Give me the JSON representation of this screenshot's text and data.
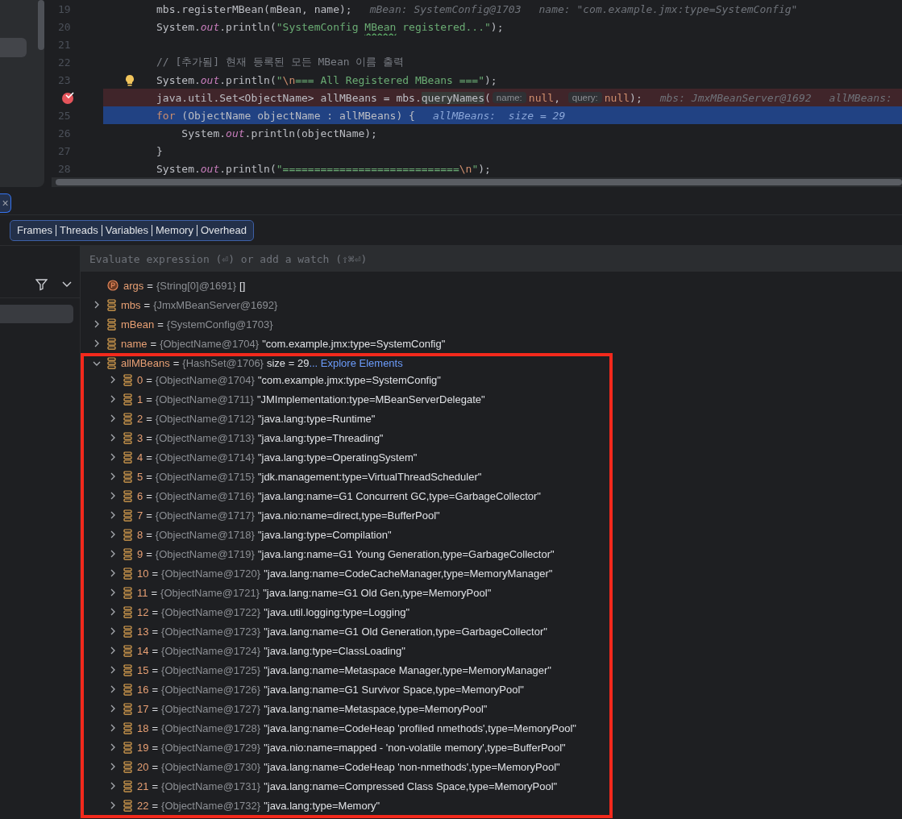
{
  "editor": {
    "lines": [
      {
        "number": "19",
        "breakpoint": false,
        "execution": false,
        "intention": false,
        "segments": [
          {
            "kind": "plain",
            "text": "mbs.registerMBean(mBean, name);"
          },
          {
            "kind": "hint",
            "text": "mBean: SystemConfig@1703"
          },
          {
            "kind": "hint",
            "text": "name: \"com.example.jmx:type=SystemConfig\""
          }
        ]
      },
      {
        "number": "20",
        "breakpoint": false,
        "execution": false,
        "intention": false,
        "segments": [
          {
            "kind": "plain",
            "text": "System."
          },
          {
            "kind": "field",
            "text": "out"
          },
          {
            "kind": "plain",
            "text": ".println("
          },
          {
            "kind": "string",
            "text": "\"SystemConfig "
          },
          {
            "kind": "typo",
            "text": "MBean"
          },
          {
            "kind": "string",
            "text": " registered...\""
          },
          {
            "kind": "plain",
            "text": ");"
          }
        ]
      },
      {
        "number": "21",
        "breakpoint": false,
        "execution": false,
        "intention": false
      },
      {
        "number": "22",
        "breakpoint": false,
        "execution": false,
        "intention": false,
        "segments": [
          {
            "kind": "comment",
            "text": "// [추가됨] 현재 등록된 모든 MBean 이름 출력"
          }
        ]
      },
      {
        "number": "23",
        "breakpoint": false,
        "execution": false,
        "intention": true,
        "segments": [
          {
            "kind": "plain",
            "text": "System."
          },
          {
            "kind": "field",
            "text": "out"
          },
          {
            "kind": "plain",
            "text": ".println("
          },
          {
            "kind": "string",
            "text": "\""
          },
          {
            "kind": "escape",
            "text": "\\n"
          },
          {
            "kind": "string",
            "text": "=== All Registered MBeans ===\""
          },
          {
            "kind": "plain",
            "text": ");"
          }
        ]
      },
      {
        "breakpoint": true,
        "execution": false,
        "intention": false,
        "segments": [
          {
            "kind": "plain",
            "text": "java.util.Set<ObjectName> allMBeans = mbs."
          },
          {
            "kind": "usage",
            "text": "queryNames"
          },
          {
            "kind": "plain",
            "text": "("
          },
          {
            "kind": "param",
            "text": "name:"
          },
          {
            "kind": "keyword",
            "text": "null"
          },
          {
            "kind": "plain",
            "text": ", "
          },
          {
            "kind": "param",
            "text": "query:"
          },
          {
            "kind": "keyword",
            "text": "null"
          },
          {
            "kind": "plain",
            "text": ");"
          },
          {
            "kind": "hint",
            "text": "mbs: JmxMBeanServer@1692"
          },
          {
            "kind": "hint",
            "text": "allMBeans:"
          }
        ]
      },
      {
        "number": "25",
        "breakpoint": false,
        "execution": true,
        "intention": false,
        "segments": [
          {
            "kind": "keyword",
            "text": "for"
          },
          {
            "kind": "plain",
            "text": " (ObjectName objectName : allMBeans) {"
          },
          {
            "kind": "hint",
            "text": "allMBeans:  size = 29"
          }
        ]
      },
      {
        "number": "26",
        "breakpoint": false,
        "execution": false,
        "intention": false,
        "segments": [
          {
            "kind": "plain",
            "text": "    System."
          },
          {
            "kind": "field",
            "text": "out"
          },
          {
            "kind": "plain",
            "text": ".println(objectName);"
          }
        ]
      },
      {
        "number": "27",
        "breakpoint": false,
        "execution": false,
        "intention": false,
        "segments": [
          {
            "kind": "plain",
            "text": "}"
          }
        ]
      },
      {
        "number": "28",
        "breakpoint": false,
        "execution": false,
        "intention": false,
        "segments": [
          {
            "kind": "plain",
            "text": "System."
          },
          {
            "kind": "field",
            "text": "out"
          },
          {
            "kind": "plain",
            "text": ".println("
          },
          {
            "kind": "string",
            "text": "\"============================"
          },
          {
            "kind": "escape",
            "text": "\\n"
          },
          {
            "kind": "string",
            "text": "\""
          },
          {
            "kind": "plain",
            "text": ");"
          }
        ]
      }
    ]
  },
  "session_tab": {
    "close": "×"
  },
  "view_tabs": [
    "Frames",
    "Threads",
    "Variables",
    "Memory",
    "Overhead"
  ],
  "evaluate": {
    "placeholder": "Evaluate expression (⏎) or add a watch (⇧⌘⏎)"
  },
  "variables": [
    {
      "kind": "param",
      "name": "args",
      "equals": "=",
      "type": "{String[0]@1691}",
      "value": "[]",
      "boxed": false
    },
    {
      "kind": "field",
      "name": "mbs",
      "equals": "=",
      "type": "{JmxMBeanServer@1692}",
      "expanded": false,
      "boxed": false
    },
    {
      "kind": "field",
      "name": "mBean",
      "equals": "=",
      "type": "{SystemConfig@1703}",
      "expanded": false,
      "boxed": false
    },
    {
      "kind": "field",
      "name": "name",
      "equals": "=",
      "type": "{ObjectName@1704}",
      "value": "\"com.example.jmx:type=SystemConfig\"",
      "expanded": false,
      "boxed": false
    },
    {
      "kind": "field",
      "name": "allMBeans",
      "equals": "=",
      "type": "{HashSet@1706}",
      "value": "size = 29",
      "link": "... Explore Elements",
      "expanded": true,
      "boxed": true,
      "children": [
        {
          "kind": "field",
          "name": "0",
          "equals": "=",
          "type": "{ObjectName@1704}",
          "value": "\"com.example.jmx:type=SystemConfig\"",
          "expanded": false
        },
        {
          "kind": "field",
          "name": "1",
          "equals": "=",
          "type": "{ObjectName@1711}",
          "value": "\"JMImplementation:type=MBeanServerDelegate\"",
          "expanded": false
        },
        {
          "kind": "field",
          "name": "2",
          "equals": "=",
          "type": "{ObjectName@1712}",
          "value": "\"java.lang:type=Runtime\"",
          "expanded": false
        },
        {
          "kind": "field",
          "name": "3",
          "equals": "=",
          "type": "{ObjectName@1713}",
          "value": "\"java.lang:type=Threading\"",
          "expanded": false
        },
        {
          "kind": "field",
          "name": "4",
          "equals": "=",
          "type": "{ObjectName@1714}",
          "value": "\"java.lang:type=OperatingSystem\"",
          "expanded": false
        },
        {
          "kind": "field",
          "name": "5",
          "equals": "=",
          "type": "{ObjectName@1715}",
          "value": "\"jdk.management:type=VirtualThreadScheduler\"",
          "expanded": false
        },
        {
          "kind": "field",
          "name": "6",
          "equals": "=",
          "type": "{ObjectName@1716}",
          "value": "\"java.lang:name=G1 Concurrent GC,type=GarbageCollector\"",
          "expanded": false
        },
        {
          "kind": "field",
          "name": "7",
          "equals": "=",
          "type": "{ObjectName@1717}",
          "value": "\"java.nio:name=direct,type=BufferPool\"",
          "expanded": false
        },
        {
          "kind": "field",
          "name": "8",
          "equals": "=",
          "type": "{ObjectName@1718}",
          "value": "\"java.lang:type=Compilation\"",
          "expanded": false
        },
        {
          "kind": "field",
          "name": "9",
          "equals": "=",
          "type": "{ObjectName@1719}",
          "value": "\"java.lang:name=G1 Young Generation,type=GarbageCollector\"",
          "expanded": false
        },
        {
          "kind": "field",
          "name": "10",
          "equals": "=",
          "type": "{ObjectName@1720}",
          "value": "\"java.lang:name=CodeCacheManager,type=MemoryManager\"",
          "expanded": false
        },
        {
          "kind": "field",
          "name": "11",
          "equals": "=",
          "type": "{ObjectName@1721}",
          "value": "\"java.lang:name=G1 Old Gen,type=MemoryPool\"",
          "expanded": false
        },
        {
          "kind": "field",
          "name": "12",
          "equals": "=",
          "type": "{ObjectName@1722}",
          "value": "\"java.util.logging:type=Logging\"",
          "expanded": false
        },
        {
          "kind": "field",
          "name": "13",
          "equals": "=",
          "type": "{ObjectName@1723}",
          "value": "\"java.lang:name=G1 Old Generation,type=GarbageCollector\"",
          "expanded": false
        },
        {
          "kind": "field",
          "name": "14",
          "equals": "=",
          "type": "{ObjectName@1724}",
          "value": "\"java.lang:type=ClassLoading\"",
          "expanded": false
        },
        {
          "kind": "field",
          "name": "15",
          "equals": "=",
          "type": "{ObjectName@1725}",
          "value": "\"java.lang:name=Metaspace Manager,type=MemoryManager\"",
          "expanded": false
        },
        {
          "kind": "field",
          "name": "16",
          "equals": "=",
          "type": "{ObjectName@1726}",
          "value": "\"java.lang:name=G1 Survivor Space,type=MemoryPool\"",
          "expanded": false
        },
        {
          "kind": "field",
          "name": "17",
          "equals": "=",
          "type": "{ObjectName@1727}",
          "value": "\"java.lang:name=Metaspace,type=MemoryPool\"",
          "expanded": false
        },
        {
          "kind": "field",
          "name": "18",
          "equals": "=",
          "type": "{ObjectName@1728}",
          "value": "\"java.lang:name=CodeHeap 'profiled nmethods',type=MemoryPool\"",
          "expanded": false
        },
        {
          "kind": "field",
          "name": "19",
          "equals": "=",
          "type": "{ObjectName@1729}",
          "value": "\"java.nio:name=mapped - 'non-volatile memory',type=BufferPool\"",
          "expanded": false
        },
        {
          "kind": "field",
          "name": "20",
          "equals": "=",
          "type": "{ObjectName@1730}",
          "value": "\"java.lang:name=CodeHeap 'non-nmethods',type=MemoryPool\"",
          "expanded": false
        },
        {
          "kind": "field",
          "name": "21",
          "equals": "=",
          "type": "{ObjectName@1731}",
          "value": "\"java.lang:name=Compressed Class Space,type=MemoryPool\"",
          "expanded": false
        },
        {
          "kind": "field",
          "name": "22",
          "equals": "=",
          "type": "{ObjectName@1732}",
          "value": "\"java.lang:type=Memory\"",
          "expanded": false
        }
      ]
    }
  ]
}
